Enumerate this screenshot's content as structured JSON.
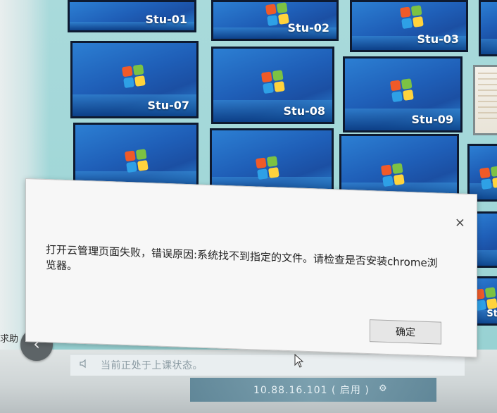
{
  "tiles": [
    {
      "label": "Stu-01"
    },
    {
      "label": "Stu-02"
    },
    {
      "label": "Stu-03"
    },
    {
      "label": "Stu-07"
    },
    {
      "label": "Stu-08"
    },
    {
      "label": "Stu-09"
    },
    {
      "label": ""
    },
    {
      "label": ""
    },
    {
      "label": ""
    },
    {
      "label": ""
    },
    {
      "label": ""
    },
    {
      "label": ""
    },
    {
      "label": "St"
    }
  ],
  "dialog": {
    "close_symbol": "×",
    "message": "打开云管理页面失败，错误原因:系统找不到指定的文件。请检查是否安装chrome浏览器。",
    "ok_label": "确定"
  },
  "sidebar": {
    "label": "求助",
    "back_symbol": "‹"
  },
  "status_bar": {
    "text": "当前正处于上课状态。",
    "speaker_icon": "speaker-icon"
  },
  "ip_bar": {
    "text": "10.88.16.101 ( 启用 )",
    "icon": "gear-icon"
  }
}
